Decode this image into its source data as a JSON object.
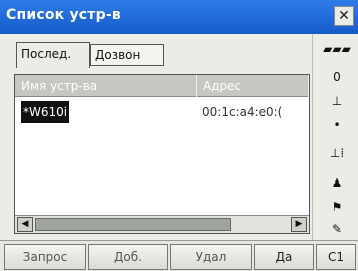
{
  "window": {
    "title": "Список устр-в"
  },
  "tabs": [
    {
      "label": "Послед."
    },
    {
      "label": "Дозвон"
    }
  ],
  "list": {
    "columns": [
      "Имя устр-ва",
      "Адрес"
    ],
    "rows": [
      {
        "name": "*W610i",
        "address": "00:1c:a4:e0:("
      }
    ]
  },
  "softkeys": [
    "Запрос",
    "Доб.",
    "Удал",
    "Да",
    "C1"
  ],
  "status": {
    "signal": "█",
    "line1": "0",
    "line2": "•",
    "flag": "⚑"
  }
}
